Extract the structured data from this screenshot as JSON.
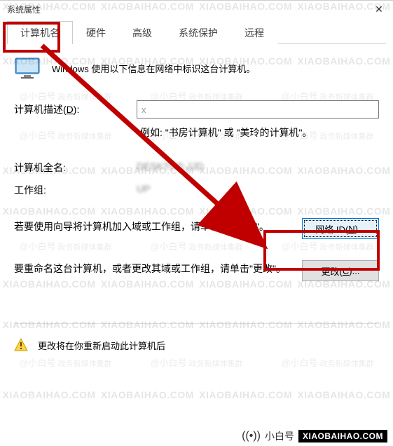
{
  "window": {
    "title": "系统属性"
  },
  "tabs": {
    "computer_name": "计算机名",
    "hardware": "硬件",
    "advanced": "高级",
    "system_protection": "系统保护",
    "remote": "远程"
  },
  "intro": "Windows 使用以下信息在网络中标识这台计算机。",
  "desc": {
    "label_prefix": "计算机描述(",
    "label_key": "D",
    "label_suffix": "):",
    "value": "x",
    "example": "例如: \"书房计算机\" 或 \"美玲的计算机\"。"
  },
  "fullname": {
    "label": "计算机全名:",
    "value": "DESKTOP-JJD"
  },
  "workgroup": {
    "label": "工作组:",
    "value": "UP"
  },
  "netid": {
    "text": "若要使用向导将计算机加入域或工作组，请单击\"网络 ID\"。",
    "btn_prefix": "网络 ID(",
    "btn_key": "N",
    "btn_suffix": ")..."
  },
  "change": {
    "text": "要重命名这台计算机，或者更改其域或工作组，请单击\"更改\"。",
    "btn_prefix": "更改(",
    "btn_key": "C",
    "btn_suffix": ")..."
  },
  "restart": {
    "text": "更改将在你重新启动此计算机后"
  },
  "watermark": {
    "big": "XIAOBAIHAO.COM",
    "small_lead": "@小白号",
    "small_tail": "政务新媒体集群"
  },
  "source": {
    "name": "小白号",
    "domain": "XIAOBAIHAO.COM"
  }
}
